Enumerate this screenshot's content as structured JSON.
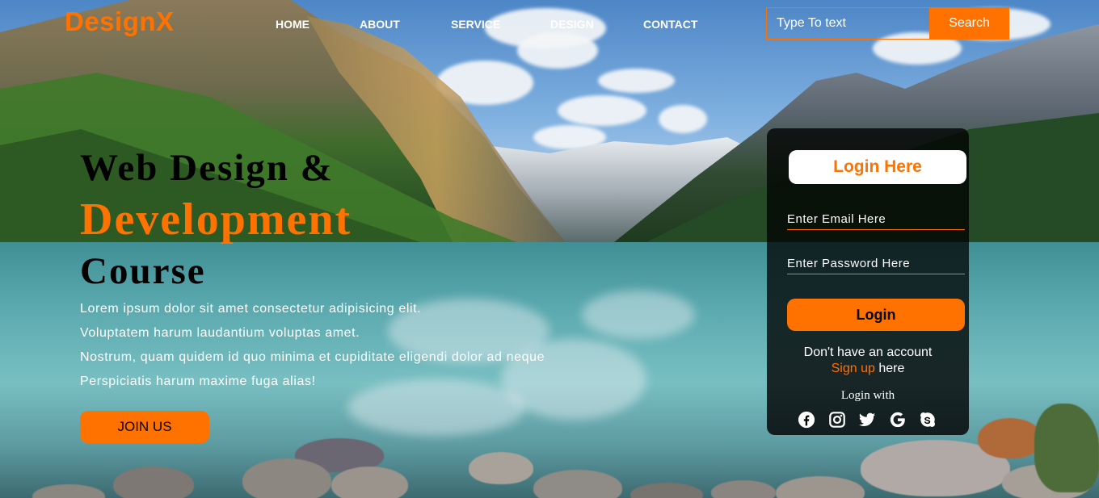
{
  "header": {
    "logo": "DesignX",
    "nav": [
      {
        "label": "HOME"
      },
      {
        "label": "ABOUT"
      },
      {
        "label": "SERVICE"
      },
      {
        "label": "DESIGN"
      },
      {
        "label": "CONTACT"
      }
    ],
    "search": {
      "placeholder": "Type To text",
      "button_label": "Search"
    }
  },
  "hero": {
    "line1": "Web Design &",
    "line2": "Development",
    "line3": "Course",
    "paragraph": [
      "Lorem ipsum dolor sit amet consectetur adipisicing elit.",
      "Voluptatem harum laudantium voluptas amet.",
      "Nostrum, quam quidem id quo minima et cupiditate eligendi dolor ad neque",
      "Perspiciatis harum maxime fuga alias!"
    ],
    "join_label": "JOIN US"
  },
  "login": {
    "title": "Login Here",
    "email_placeholder": "Enter Email Here",
    "password_placeholder": "Enter Password Here",
    "button_label": "Login",
    "signup_prefix": "Don't have an account",
    "signup_link": "Sign up",
    "signup_suffix": " here",
    "login_with": "Login with",
    "socials": [
      "facebook-icon",
      "instagram-icon",
      "twitter-icon",
      "google-icon",
      "skype-icon"
    ]
  },
  "colors": {
    "accent": "#ff7200",
    "text_light": "#ffffff",
    "text_dark": "#000000"
  }
}
